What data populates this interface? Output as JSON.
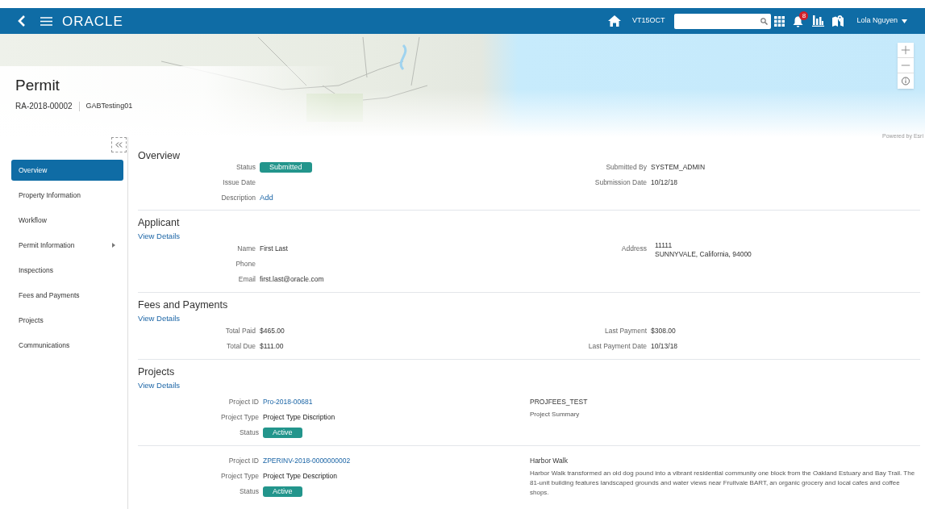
{
  "header": {
    "logo": "ORACLE",
    "context": "VT15OCT",
    "notification_count": "8",
    "user": "Lola Nguyen"
  },
  "map": {
    "attribution": "Powered by Esri"
  },
  "record": {
    "title": "Permit",
    "number": "RA-2018-00002",
    "name": "GABTesting01"
  },
  "sidebar": {
    "items": [
      {
        "label": "Overview",
        "selected": true,
        "has_submenu": false
      },
      {
        "label": "Property Information",
        "selected": false,
        "has_submenu": false
      },
      {
        "label": "Workflow",
        "selected": false,
        "has_submenu": false
      },
      {
        "label": "Permit Information",
        "selected": false,
        "has_submenu": true
      },
      {
        "label": "Inspections",
        "selected": false,
        "has_submenu": false
      },
      {
        "label": "Fees and Payments",
        "selected": false,
        "has_submenu": false
      },
      {
        "label": "Projects",
        "selected": false,
        "has_submenu": false
      },
      {
        "label": "Communications",
        "selected": false,
        "has_submenu": false
      }
    ]
  },
  "sections": [
    {
      "title": "Overview",
      "left": [
        {
          "label": "Status",
          "kind": "badge",
          "value": "Submitted"
        },
        {
          "label": "Issue Date",
          "kind": "text"
        },
        {
          "label": "Description",
          "kind": "link",
          "value": "Add"
        }
      ],
      "right": [
        {
          "label": "Submitted By",
          "kind": "text",
          "value": "SYSTEM_ADMIN"
        },
        {
          "label": "Submission Date",
          "kind": "text",
          "value": "10/12/18"
        }
      ]
    },
    {
      "title": "Applicant",
      "link": "View Details",
      "left": [
        {
          "label": "Name",
          "kind": "text",
          "value": "First Last"
        },
        {
          "label": "Phone",
          "kind": "text"
        },
        {
          "label": "Email",
          "kind": "text",
          "value": "first.last@oracle.com"
        }
      ],
      "right": [
        {
          "label": "Address",
          "kind": "lines",
          "lines": [
            "11111",
            "SUNNYVALE, California, 94000"
          ]
        }
      ]
    },
    {
      "title": "Fees and Payments",
      "link": "View Details",
      "left": [
        {
          "label": "Total Paid",
          "kind": "text",
          "value": "$465.00"
        },
        {
          "label": "Total Due",
          "kind": "text",
          "value": "$111.00"
        }
      ],
      "right": [
        {
          "label": "Last Payment",
          "kind": "text",
          "value": "$308.00"
        },
        {
          "label": "Last Payment Date",
          "kind": "text",
          "value": "10/13/18"
        }
      ]
    }
  ],
  "projects": {
    "title": "Projects",
    "link": "View Details",
    "items": [
      {
        "project_id": "Pro-2018-00681",
        "project_type": "Project Type Discription",
        "status": "Active",
        "name": "PROJFEES_TEST",
        "summary": "Project Summary",
        "labels": [
          "Project ID",
          "Project Type",
          "Status"
        ]
      },
      {
        "project_id": "ZPERINV-2018-0000000002",
        "project_type": "Project Type Description",
        "status": "Active",
        "name": "Harbor Walk",
        "summary": "Harbor Walk transformed an old dog pound into a vibrant residential community one block from the Oakland Estuary and Bay Trail. The 81-unit building features landscaped grounds and water views near Fruitvale BART, an organic grocery and local cafes and coffee shops.",
        "labels": [
          "Project ID",
          "Project Type",
          "Status"
        ]
      }
    ]
  }
}
